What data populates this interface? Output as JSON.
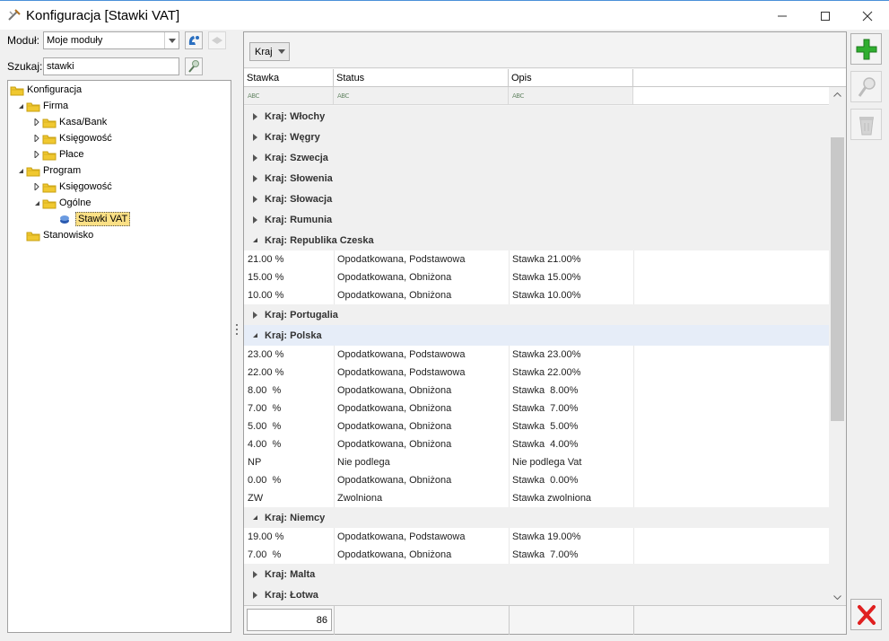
{
  "window": {
    "title": "Konfiguracja [Stawki VAT]"
  },
  "left": {
    "module_label": "Moduł:",
    "module_value": "Moje moduły",
    "search_label": "Szukaj:",
    "search_value": "stawki"
  },
  "tree": [
    {
      "label": "Konfiguracja",
      "level": 0,
      "state": "none"
    },
    {
      "label": "Firma",
      "level": 1,
      "state": "expanded"
    },
    {
      "label": "Kasa/Bank",
      "level": 2,
      "state": "collapsed"
    },
    {
      "label": "Księgowość",
      "level": 2,
      "state": "collapsed"
    },
    {
      "label": "Płace",
      "level": 2,
      "state": "collapsed"
    },
    {
      "label": "Program",
      "level": 1,
      "state": "expanded"
    },
    {
      "label": "Księgowość",
      "level": 2,
      "state": "collapsed"
    },
    {
      "label": "Ogólne",
      "level": 2,
      "state": "expanded"
    },
    {
      "label": "Stawki VAT",
      "level": 3,
      "state": "leaf",
      "selected": true
    },
    {
      "label": "Stanowisko",
      "level": 1,
      "state": "none"
    }
  ],
  "grid": {
    "group_button": "Kraj",
    "columns": [
      "Stawka",
      "Status",
      "Opis"
    ],
    "rows": [
      {
        "type": "group",
        "label": "Kraj: Włochy",
        "expanded": false
      },
      {
        "type": "group",
        "label": "Kraj: Węgry",
        "expanded": false
      },
      {
        "type": "group",
        "label": "Kraj: Szwecja",
        "expanded": false
      },
      {
        "type": "group",
        "label": "Kraj: Słowenia",
        "expanded": false
      },
      {
        "type": "group",
        "label": "Kraj: Słowacja",
        "expanded": false
      },
      {
        "type": "group",
        "label": "Kraj: Rumunia",
        "expanded": false
      },
      {
        "type": "group",
        "label": "Kraj: Republika Czeska",
        "expanded": true
      },
      {
        "type": "data",
        "stawka": "21.00 %",
        "status": "Opodatkowana, Podstawowa",
        "opis": "Stawka 21.00%"
      },
      {
        "type": "data",
        "stawka": "15.00 %",
        "status": "Opodatkowana, Obniżona",
        "opis": "Stawka 15.00%"
      },
      {
        "type": "data",
        "stawka": "10.00 %",
        "status": "Opodatkowana, Obniżona",
        "opis": "Stawka 10.00%"
      },
      {
        "type": "group",
        "label": "Kraj: Portugalia",
        "expanded": false
      },
      {
        "type": "group",
        "label": "Kraj: Polska",
        "expanded": true,
        "current": true
      },
      {
        "type": "data",
        "stawka": "23.00 %",
        "status": "Opodatkowana, Podstawowa",
        "opis": "Stawka 23.00%"
      },
      {
        "type": "data",
        "stawka": "22.00 %",
        "status": "Opodatkowana, Podstawowa",
        "opis": "Stawka 22.00%"
      },
      {
        "type": "data",
        "stawka": "8.00  %",
        "status": "Opodatkowana, Obniżona",
        "opis": "Stawka  8.00%"
      },
      {
        "type": "data",
        "stawka": "7.00  %",
        "status": "Opodatkowana, Obniżona",
        "opis": "Stawka  7.00%"
      },
      {
        "type": "data",
        "stawka": "5.00  %",
        "status": "Opodatkowana, Obniżona",
        "opis": "Stawka  5.00%"
      },
      {
        "type": "data",
        "stawka": "4.00  %",
        "status": "Opodatkowana, Obniżona",
        "opis": "Stawka  4.00%"
      },
      {
        "type": "data",
        "stawka": "NP",
        "status": "Nie podlega",
        "opis": "Nie podlega Vat"
      },
      {
        "type": "data",
        "stawka": "0.00  %",
        "status": "Opodatkowana, Obniżona",
        "opis": "Stawka  0.00%"
      },
      {
        "type": "data",
        "stawka": "ZW",
        "status": "Zwolniona",
        "opis": "Stawka zwolniona"
      },
      {
        "type": "group",
        "label": "Kraj: Niemcy",
        "expanded": true
      },
      {
        "type": "data",
        "stawka": "19.00 %",
        "status": "Opodatkowana, Podstawowa",
        "opis": "Stawka 19.00%"
      },
      {
        "type": "data",
        "stawka": "7.00  %",
        "status": "Opodatkowana, Obniżona",
        "opis": "Stawka  7.00%"
      },
      {
        "type": "group",
        "label": "Kraj: Malta",
        "expanded": false
      },
      {
        "type": "group",
        "label": "Kraj: Łotwa",
        "expanded": false
      }
    ],
    "record_count": "86"
  },
  "icons": {
    "app": "tools-icon",
    "module_contact": "contact-icon",
    "module_extra": "disabled-icon",
    "search_go": "search-icon",
    "add": "plus-icon",
    "edit": "magnifier-icon",
    "delete": "trash-icon",
    "close": "close-red-icon"
  },
  "colors": {
    "selection": "#fbe085",
    "add_green": "#2fae2f",
    "close_red": "#e02020",
    "current_group": "#e6edf8"
  }
}
